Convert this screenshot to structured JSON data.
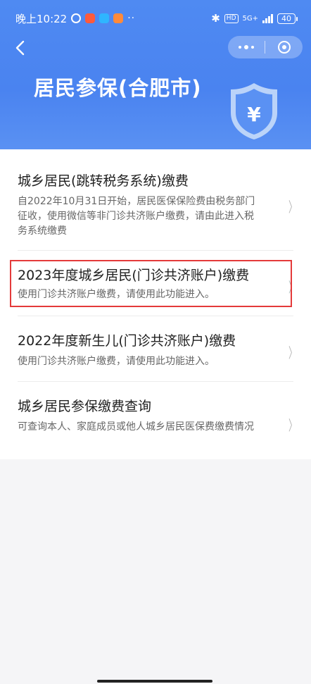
{
  "status_bar": {
    "time": "晚上10:22",
    "dots": "··",
    "bluetooth": "✱",
    "hd": "HD",
    "network": "5G+",
    "battery": "40"
  },
  "nav": {
    "back_icon": "chevron-left-icon",
    "more_icon": "more-dots-icon",
    "close_icon": "target-close-icon"
  },
  "header": {
    "title": "居民参保(合肥市)",
    "shield_symbol": "¥",
    "colors": {
      "bg": "#4a83f0",
      "shield_fill": "#b9d1f8"
    }
  },
  "items": [
    {
      "title": "城乡居民(跳转税务系统)缴费",
      "desc": "自2022年10月31日开始，居民医保保险费由税务部门征收，使用微信等非门诊共济账户缴费，请由此进入税务系统缴费"
    },
    {
      "title": "2023年度城乡居民(门诊共济账户)缴费",
      "desc": "使用门诊共济账户缴费，请使用此功能进入。"
    },
    {
      "title": "2022年度新生儿(门诊共济账户)缴费",
      "desc": "使用门诊共济账户缴费，请使用此功能进入。"
    },
    {
      "title": "城乡居民参保缴费查询",
      "desc": "可查询本人、家庭成员或他人城乡居民医保费缴费情况"
    }
  ],
  "chevron": "〉"
}
